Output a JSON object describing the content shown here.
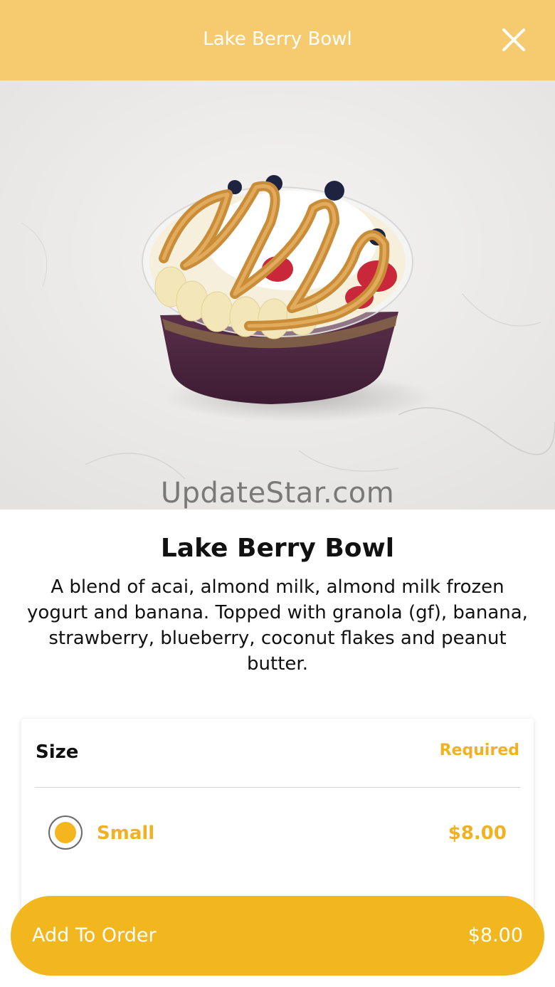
{
  "header": {
    "title": "Lake Berry Bowl",
    "close_icon": "close-icon"
  },
  "hero": {
    "watermark": "UpdateStar.com"
  },
  "product": {
    "name": "Lake Berry Bowl",
    "description": "A blend of acai, almond milk, almond milk frozen yogurt and banana. Topped with granola (gf), banana, strawberry, blueberry, coconut flakes and peanut butter."
  },
  "options": {
    "title": "Size",
    "required_label": "Required",
    "items": [
      {
        "label": "Small",
        "price": "$8.00",
        "selected": true
      }
    ]
  },
  "cta": {
    "label": "Add To Order",
    "price": "$8.00"
  },
  "colors": {
    "header": "#f6cb6f",
    "accent": "#f2b61f",
    "text": "#111111"
  }
}
